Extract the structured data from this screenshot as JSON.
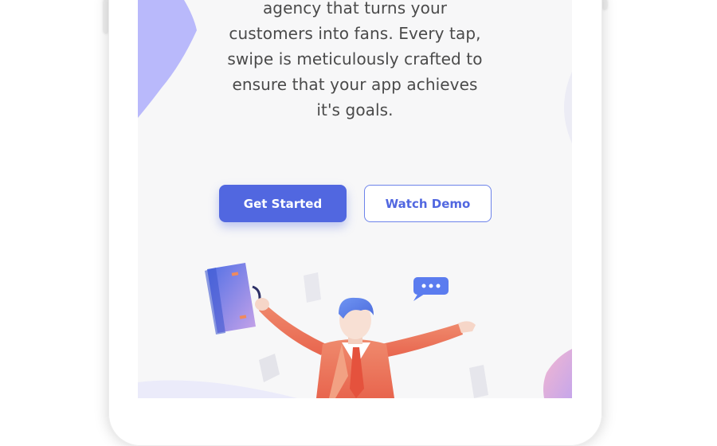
{
  "hero": {
    "description_lines": [
      "agency that turns your",
      "customers into fans. Every tap,",
      "swipe is meticulously crafted to",
      "ensure that your app achieves",
      "it's goals."
    ]
  },
  "actions": {
    "primary_label": "Get Started",
    "secondary_label": "Watch Demo"
  },
  "colors": {
    "accent": "#5167e0",
    "screen_background": "#f7f7f8",
    "decor_purple": "#b9b9fb"
  },
  "icons": {
    "illustration": "celebrating-businessman",
    "chat_bubble": "chat-bubble-icon"
  }
}
